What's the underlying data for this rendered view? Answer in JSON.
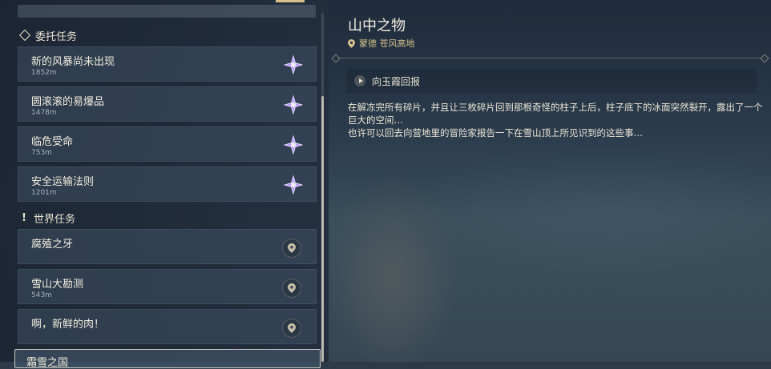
{
  "commission_section": {
    "title": "委托任务"
  },
  "commission_quests": [
    {
      "name": "新的风暴尚未出现",
      "distance": "1852m"
    },
    {
      "name": "圆滚滚的易爆品",
      "distance": "1478m"
    },
    {
      "name": "临危受命",
      "distance": "753m"
    },
    {
      "name": "安全运输法则",
      "distance": "1201m"
    }
  ],
  "world_section": {
    "title": "世界任务"
  },
  "world_quests": [
    {
      "name": "腐殖之牙",
      "distance": ""
    },
    {
      "name": "雪山大勘测",
      "distance": "543m"
    },
    {
      "name": "啊，新鲜的肉！",
      "distance": ""
    }
  ],
  "selected_partial": {
    "name": "霜雪之国"
  },
  "detail": {
    "title": "山中之物",
    "location": "蒙德 苍风高地",
    "step": "向玉霞回报",
    "description_lines": [
      "在解冻完所有碎片，并且让三枚碎片回到那根奇怪的柱子上后，柱子底下的冰面突然裂开，露出了一个巨大的空间…",
      "也许可以回去向营地里的冒险家报告一下在雪山顶上所见识到的这些事…"
    ]
  },
  "colors": {
    "accent_gold": "#d5c08a",
    "star_purple": "#b79cff"
  },
  "icons": {
    "commission": "diamond-icon",
    "world": "exclamation-icon",
    "commission_marker": "purple-star-icon",
    "world_marker": "map-pin-icon",
    "step": "play-icon"
  }
}
